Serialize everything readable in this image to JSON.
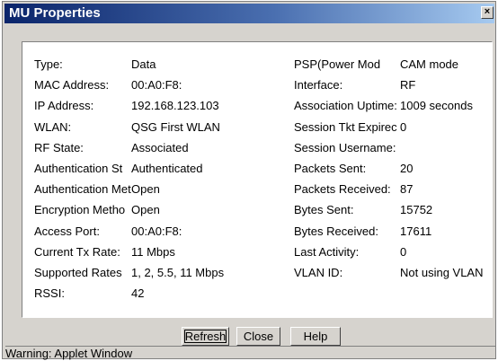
{
  "window": {
    "title": "MU Properties",
    "close_glyph": "×"
  },
  "left_fields": [
    {
      "label": "Type:",
      "value": "Data"
    },
    {
      "label": "MAC Address:",
      "value": "00:A0:F8:"
    },
    {
      "label": "IP Address:",
      "value": "192.168.123.103"
    },
    {
      "label": "WLAN:",
      "value": "QSG First WLAN"
    },
    {
      "label": "RF State:",
      "value": "Associated"
    },
    {
      "label": "Authentication St",
      "value": "Authenticated"
    },
    {
      "label": "Authentication Metl",
      "value": "Open"
    },
    {
      "label": "Encryption Metho",
      "value": "Open"
    },
    {
      "label": "Access Port:",
      "value": "00:A0:F8:"
    },
    {
      "label": "Current Tx Rate:",
      "value": "11 Mbps"
    },
    {
      "label": "Supported Rates",
      "value": "1, 2, 5.5, 11 Mbps"
    },
    {
      "label": "RSSI:",
      "value": "42"
    }
  ],
  "right_fields": [
    {
      "label": "PSP(Power Mod",
      "value": "CAM mode"
    },
    {
      "label": "Interface:",
      "value": "RF"
    },
    {
      "label": "Association Uptime:",
      "value": "1009 seconds"
    },
    {
      "label": "Session Tkt Expirec",
      "value": "0"
    },
    {
      "label": "Session Username:",
      "value": ""
    },
    {
      "label": "Packets Sent:",
      "value": "20"
    },
    {
      "label": "Packets Received:",
      "value": "87"
    },
    {
      "label": "Bytes Sent:",
      "value": "15752"
    },
    {
      "label": "Bytes Received:",
      "value": "17611"
    },
    {
      "label": "Last Activity:",
      "value": "0"
    },
    {
      "label": "VLAN ID:",
      "value": "Not using VLAN"
    }
  ],
  "buttons": {
    "refresh": "Refresh",
    "close": "Close",
    "help": "Help"
  },
  "status_bar": {
    "text": "Warning: Applet Window"
  }
}
